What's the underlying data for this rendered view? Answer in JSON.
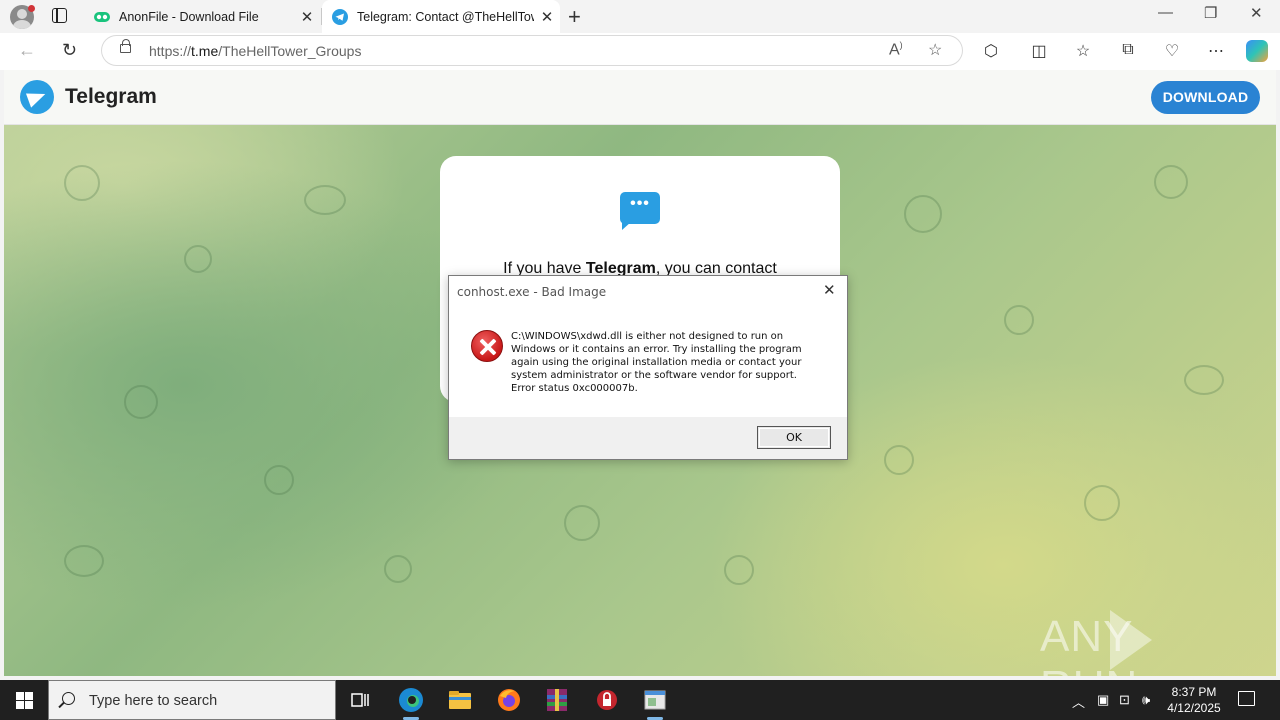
{
  "browser": {
    "tabs": [
      {
        "title": "AnonFile - Download File",
        "active": false
      },
      {
        "title": "Telegram: Contact @TheHellTower_Groups",
        "active": true
      }
    ],
    "url_prefix": "https://",
    "url_host": "t.me",
    "url_path": "/TheHellTower_Groups"
  },
  "telegram": {
    "brand": "Telegram",
    "download_label": "DOWNLOAD",
    "card_text_pre": "If you have ",
    "card_text_bold": "Telegram",
    "card_text_post": ", you can contact",
    "bubble_dots": "•••"
  },
  "dialog": {
    "title": "conhost.exe - Bad Image",
    "message_lines": [
      "C:\\WINDOWS\\xdwd.dll is either not designed to run on",
      "Windows or it contains an error. Try installing the program",
      "again using the original installation media or contact your",
      "system administrator or the software vendor for support.",
      "Error status 0xc000007b."
    ],
    "ok_label": "OK"
  },
  "watermark": {
    "left": "ANY",
    "right": "RUN"
  },
  "taskbar": {
    "search_placeholder": "Type here to search",
    "time": "8:37 PM",
    "date": "4/12/2025"
  },
  "colors": {
    "telegram_blue": "#2a9ee2",
    "download_button": "#2a83d3",
    "taskbar": "#202020",
    "error_red": "#c81818"
  }
}
